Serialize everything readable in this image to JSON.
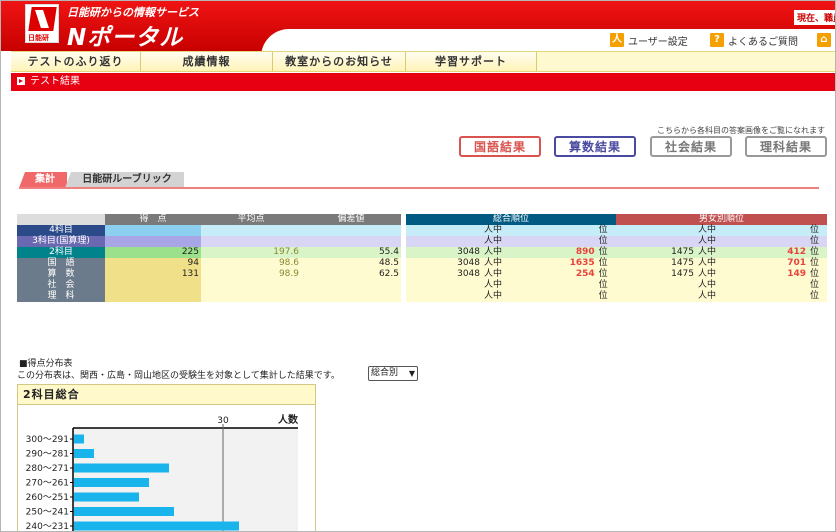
{
  "header": {
    "tagline": "日能研からの情報サービス",
    "portal_title": "Nポータル",
    "logo_text": "日能研",
    "corner_text": "現在、職員",
    "util": [
      {
        "icon": "person-icon",
        "glyph": "人",
        "label": "ユーザー設定"
      },
      {
        "icon": "question-icon",
        "glyph": "?",
        "label": "よくあるご質問"
      },
      {
        "icon": "home-icon",
        "glyph": "⌂",
        "label": ""
      }
    ]
  },
  "nav": {
    "tabs": [
      "テストのふり返り",
      "成績情報",
      "教室からのお知らせ",
      "学習サポート"
    ]
  },
  "breadcrumb": {
    "label": "テスト結果"
  },
  "subjects": {
    "note": "こちらから各科目の答案画像をご覧になれます",
    "buttons": [
      {
        "label": "国語結果",
        "color": "#d9534f"
      },
      {
        "label": "算数結果",
        "color": "#4a4aa0"
      },
      {
        "label": "社会結果",
        "color": "#888888"
      },
      {
        "label": "理科結果",
        "color": "#888888"
      }
    ]
  },
  "result_tabs": [
    {
      "label": "集計",
      "active": true
    },
    {
      "label": "日能研ルーブリック",
      "active": false
    }
  ],
  "score_table": {
    "headers": [
      "得　点",
      "平均点",
      "偏差値"
    ],
    "rows": [
      {
        "label": "4科目",
        "score": "",
        "avg": "",
        "dev": "",
        "color": "#2a4a8a",
        "bg": "#c6ecf8"
      },
      {
        "label": "3科目(国算理)",
        "score": "",
        "avg": "",
        "dev": "",
        "color": "#6a68b0",
        "bg": "#d8d6f4"
      },
      {
        "label": "2科目",
        "score": "225",
        "avg": "197.6",
        "dev": "55.4",
        "color": "#00838a",
        "bg": "#d9f5c8"
      },
      {
        "label": "国　語",
        "score": "94",
        "avg": "98.6",
        "dev": "48.5",
        "color": "#6c7b8b",
        "bg": "#fffbd0"
      },
      {
        "label": "算　数",
        "score": "131",
        "avg": "98.9",
        "dev": "62.5",
        "color": "#6c7b8b",
        "bg": "#fffbd0"
      },
      {
        "label": "社　会",
        "score": "",
        "avg": "",
        "dev": "",
        "color": "#6c7b8b",
        "bg": "#fffbd0"
      },
      {
        "label": "理　科",
        "score": "",
        "avg": "",
        "dev": "",
        "color": "#6c7b8b",
        "bg": "#fffbd0"
      }
    ]
  },
  "rank_table": {
    "headers": [
      "総合順位",
      "男女別順位"
    ],
    "header_colors": [
      "#005a82",
      "#c05050"
    ],
    "person_unit": "人中",
    "rank_unit": "位",
    "rows": [
      {
        "total": "",
        "rank": "",
        "g_total": "",
        "g_rank": "",
        "bg": "#c6ecf8"
      },
      {
        "total": "",
        "rank": "",
        "g_total": "",
        "g_rank": "",
        "bg": "#d8d6f4"
      },
      {
        "total": "3048",
        "rank": "890",
        "g_total": "1475",
        "g_rank": "412",
        "bg": "#d9f5c8"
      },
      {
        "total": "3048",
        "rank": "1635",
        "g_total": "1475",
        "g_rank": "701",
        "bg": "#fffbd0"
      },
      {
        "total": "3048",
        "rank": "254",
        "g_total": "1475",
        "g_rank": "149",
        "bg": "#fffbd0"
      },
      {
        "total": "",
        "rank": "",
        "g_total": "",
        "g_rank": "",
        "bg": "#fffbd0"
      },
      {
        "total": "",
        "rank": "",
        "g_total": "",
        "g_rank": "",
        "bg": "#fffbd0"
      }
    ]
  },
  "distribution": {
    "title": "■得点分布表",
    "description": "この分布表は、関西・広島・岡山地区の受験生を対象として集計した結果です。",
    "select_value": "総合別",
    "chart_title": "2科目総合"
  },
  "chart_data": {
    "type": "bar",
    "orientation": "horizontal",
    "title": "2科目総合",
    "xlabel": "人数",
    "x_ticks": [
      30
    ],
    "categories": [
      "300～291",
      "290～281",
      "280～271",
      "270～261",
      "260～251",
      "250～241",
      "240～231"
    ],
    "values": [
      2,
      4,
      19,
      15,
      13,
      20,
      33
    ],
    "bar_color": "#1ab4ec"
  }
}
